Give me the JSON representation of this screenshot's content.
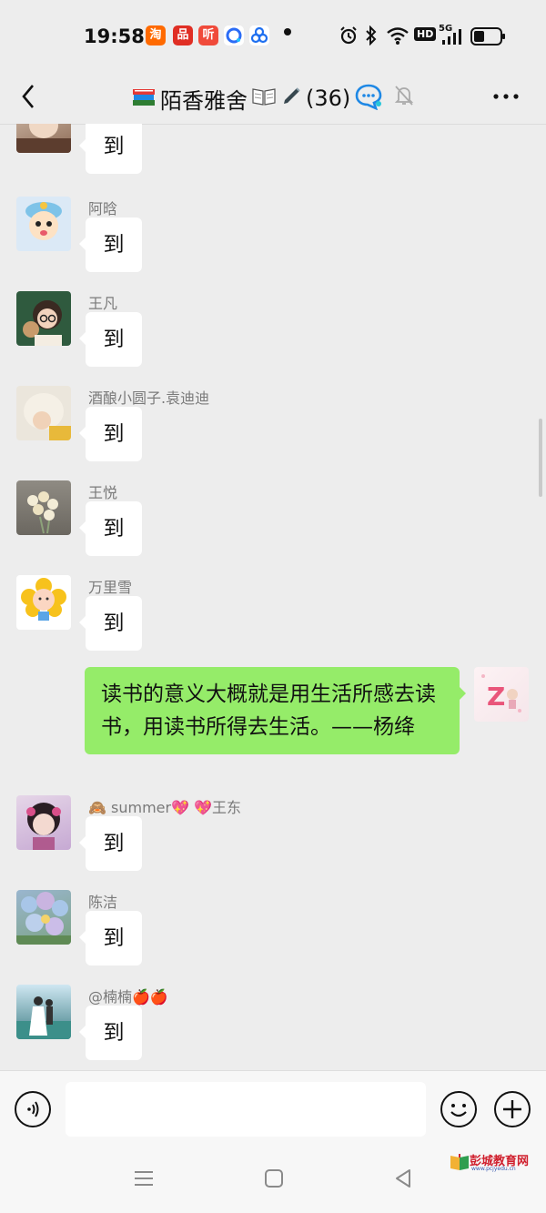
{
  "status_bar": {
    "time": "19:58",
    "app_icons": [
      {
        "name": "taobao-icon",
        "glyph": "淘",
        "color": "#ff6a00"
      },
      {
        "name": "pinduoduo-icon",
        "glyph": "品",
        "color": "#e02e24"
      },
      {
        "name": "ting-icon",
        "glyph": "听",
        "color": "#f04a3a"
      },
      {
        "name": "browser-icon",
        "glyph": "",
        "color": "#2b6cf6"
      },
      {
        "name": "share-icon",
        "glyph": "",
        "color": "#1e6ff0"
      }
    ],
    "hd_label": "HD",
    "network_label": "5G"
  },
  "header": {
    "title": "陌香雅舍",
    "member_count": "(36)"
  },
  "messages": [
    {
      "sender": "",
      "text": "到"
    },
    {
      "sender": "阿晗",
      "text": "到"
    },
    {
      "sender": "王凡",
      "text": "到"
    },
    {
      "sender": "酒酿小圆子.袁迪迪",
      "text": "到"
    },
    {
      "sender": "王悦",
      "text": "到"
    },
    {
      "sender": "万里雪",
      "text": "到"
    }
  ],
  "my_message": {
    "text": "读书的意义大概就是用生活所感去读书，用读书所得去生活。——杨绛",
    "avatar_letter": "Z"
  },
  "messages_after": [
    {
      "sender": "🙈 summer💖 💖王东",
      "text": "到"
    },
    {
      "sender": "陈洁",
      "text": "到"
    },
    {
      "sender": "@楠楠🍎🍎",
      "text": "到"
    }
  ],
  "input": {
    "value": "",
    "placeholder": ""
  },
  "watermark": {
    "text": "彭城教育网",
    "url": "www.pcjyedu.cn"
  },
  "colors": {
    "my_bubble": "#95ec69",
    "background": "#ededed"
  }
}
